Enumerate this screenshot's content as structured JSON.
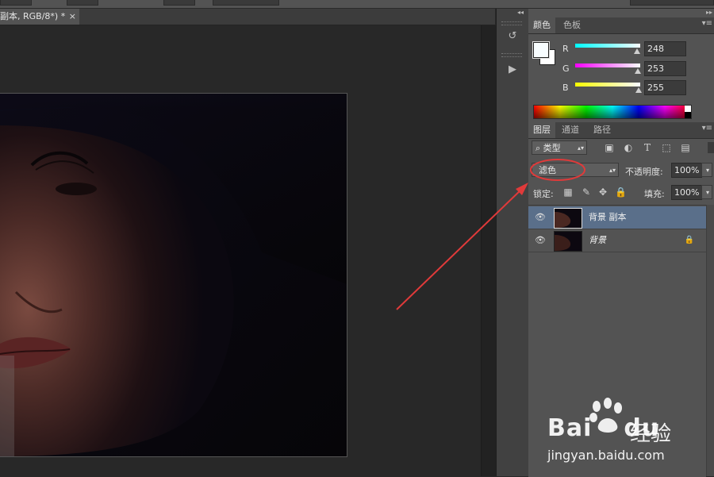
{
  "document": {
    "tab_title": "副本, RGB/8*) *",
    "close_glyph": "×"
  },
  "color_panel": {
    "tabs": [
      "颜色",
      "色板"
    ],
    "r_label": "R",
    "r_value": "248",
    "g_label": "G",
    "g_value": "253",
    "b_label": "B",
    "b_value": "255",
    "r_level": 0.97,
    "g_level": 0.99,
    "b_level": 1.0
  },
  "layers_panel": {
    "tabs": [
      "图层",
      "通道",
      "路径"
    ],
    "filter_kind": "类型",
    "blend_mode": "滤色",
    "opacity_label": "不透明度:",
    "opacity_value": "100%",
    "lock_label": "锁定:",
    "fill_label": "填充:",
    "fill_value": "100%",
    "layers": [
      {
        "name": "背景 副本",
        "selected": true,
        "locked": false
      },
      {
        "name": "背景",
        "selected": false,
        "locked": true
      }
    ]
  },
  "colors": {
    "annotation_red": "#e03a3a",
    "selection_blue": "#5a6f8a",
    "panel_bg": "#535353",
    "canvas_bg": "#282828"
  },
  "watermark": {
    "brand": "Bai",
    "brand2": "du",
    "product": "经验",
    "url": "jingyan.baidu.com"
  }
}
